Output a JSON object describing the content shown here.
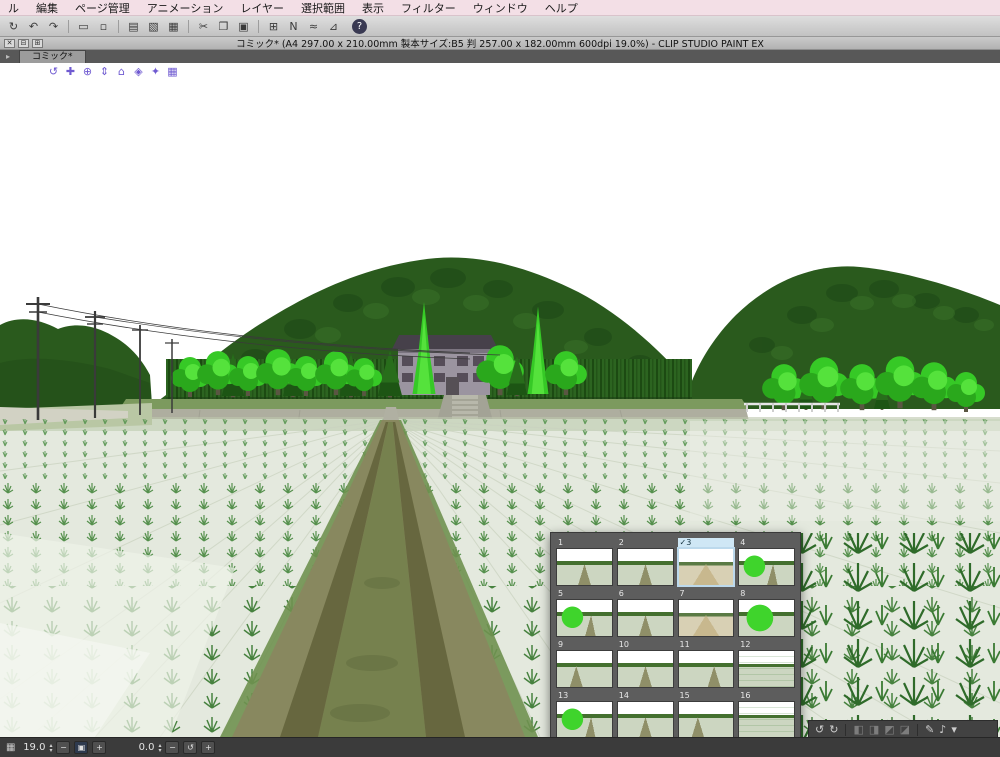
{
  "menu_bar": {
    "items": [
      "ル",
      "編集",
      "ページ管理",
      "アニメーション",
      "レイヤー",
      "選択範囲",
      "表示",
      "フィルター",
      "ウィンドウ",
      "ヘルプ"
    ]
  },
  "toolbar": {
    "icons": [
      "↻",
      "↶",
      "↷",
      "▭",
      "▫",
      "▤",
      "▧",
      "▦",
      "✂",
      "❐",
      "▣",
      "⊞",
      "N",
      "≈",
      "⊿",
      "?"
    ]
  },
  "title_bar": {
    "controls": [
      "✕",
      "⊟",
      "⊞"
    ],
    "text": "コミック* (A4 297.00 x 210.00mm 製本サイズ:B5 判 257.00 x 182.00mm 600dpi 19.0%)  - CLIP STUDIO PAINT EX"
  },
  "tab_bar": {
    "nav": "▸",
    "tabs": [
      {
        "label": "コミック*"
      }
    ]
  },
  "gizmo_bar": {
    "icons": [
      "↺",
      "✚",
      "⊕",
      "⇕",
      "⌂",
      "◈",
      "✦",
      "▦"
    ]
  },
  "scene": {
    "colors": {
      "sky": "#ffffff",
      "hill": "#2a5a1d",
      "hill_shade": "#1d4716",
      "tree_bright": "#36c926",
      "tree_dark": "#1d5514",
      "field": "#e4e9de",
      "road": "#88885f",
      "road_track": "#67673f",
      "embankment": "#aeae9f"
    }
  },
  "preset_panel": {
    "items": [
      "1",
      "2",
      "✓3",
      "4",
      "5",
      "6",
      "7",
      "8",
      "9",
      "10",
      "11",
      "12",
      "13",
      "14",
      "15",
      "16"
    ],
    "selected": "3"
  },
  "object_toolbar": {
    "left": [
      "↺",
      "↻"
    ],
    "middle": [
      "◧",
      "◨",
      "◩",
      "◪"
    ],
    "right": [
      "✎",
      "♪",
      "▾"
    ]
  },
  "status_bar": {
    "zoom_value": "19.0",
    "rotation_value": "0.0",
    "icons": {
      "grid": "▦",
      "step_up": "▴",
      "step_down": "▾",
      "minus": "−",
      "plus": "+",
      "fit": "▣",
      "rotate": "↺"
    }
  }
}
